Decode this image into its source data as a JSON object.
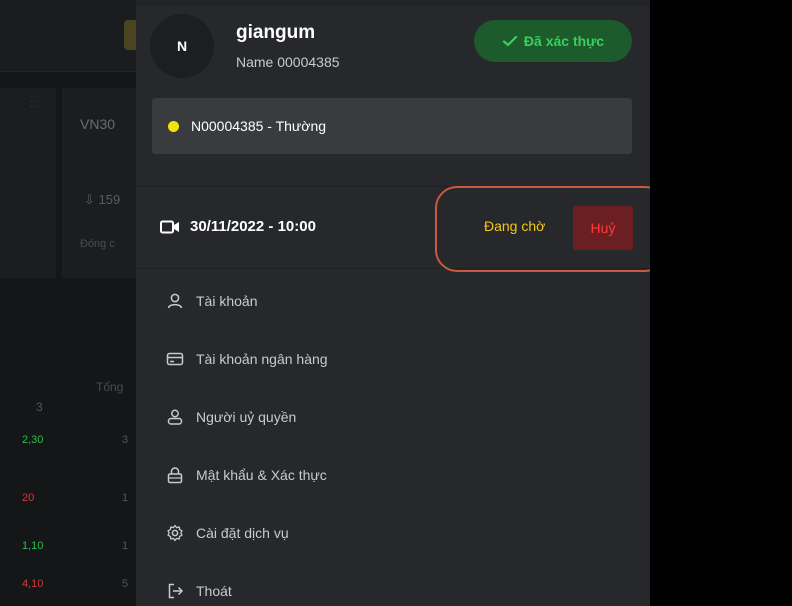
{
  "background": {
    "index_label": "VN30",
    "index_value": "⇩ 159",
    "index_status": "Đóng c",
    "column_header": "Tổng",
    "row_label": "3",
    "rows": [
      {
        "left": "2,30",
        "right": "3",
        "color": "#2bbf4a"
      },
      {
        "left": "20",
        "right": "1",
        "color": "#d23b3b"
      },
      {
        "left": "1,10",
        "right": "1",
        "color": "#2bbf4a"
      },
      {
        "left": "4,10",
        "right": "5",
        "color": "#d23b3b"
      }
    ]
  },
  "user": {
    "avatar_initial": "N",
    "username": "giangum",
    "display_name": "Name 00004385",
    "verified_label": "Đã xác thực",
    "verified_icon": "check-icon"
  },
  "account": {
    "label": "N00004385 - Thường",
    "dot_color": "#f1e30e"
  },
  "appointment": {
    "icon": "video-camera-icon",
    "datetime": "30/11/2022 - 10:00",
    "status": "Đang chờ",
    "cancel_label": "Huỷ"
  },
  "menu": {
    "items": [
      {
        "label": "Tài khoản",
        "icon": "user-icon"
      },
      {
        "label": "Tài khoản ngân hàng",
        "icon": "credit-card-icon"
      },
      {
        "label": "Người uỷ quyền",
        "icon": "user-outline-icon"
      },
      {
        "label": "Mật khẩu & Xác thực",
        "icon": "lock-icon"
      },
      {
        "label": "Cài đặt dịch vụ",
        "icon": "gear-icon"
      },
      {
        "label": "Thoát",
        "icon": "logout-icon"
      }
    ]
  },
  "colors": {
    "panel": "#27282b",
    "verified_bg": "#1d5a2c",
    "verified_text": "#38d15a",
    "status_pending": "#f5c518",
    "cancel_bg": "#6b1f22",
    "cancel_text": "#ff3b3b",
    "highlight_ring": "#c85a3e"
  }
}
